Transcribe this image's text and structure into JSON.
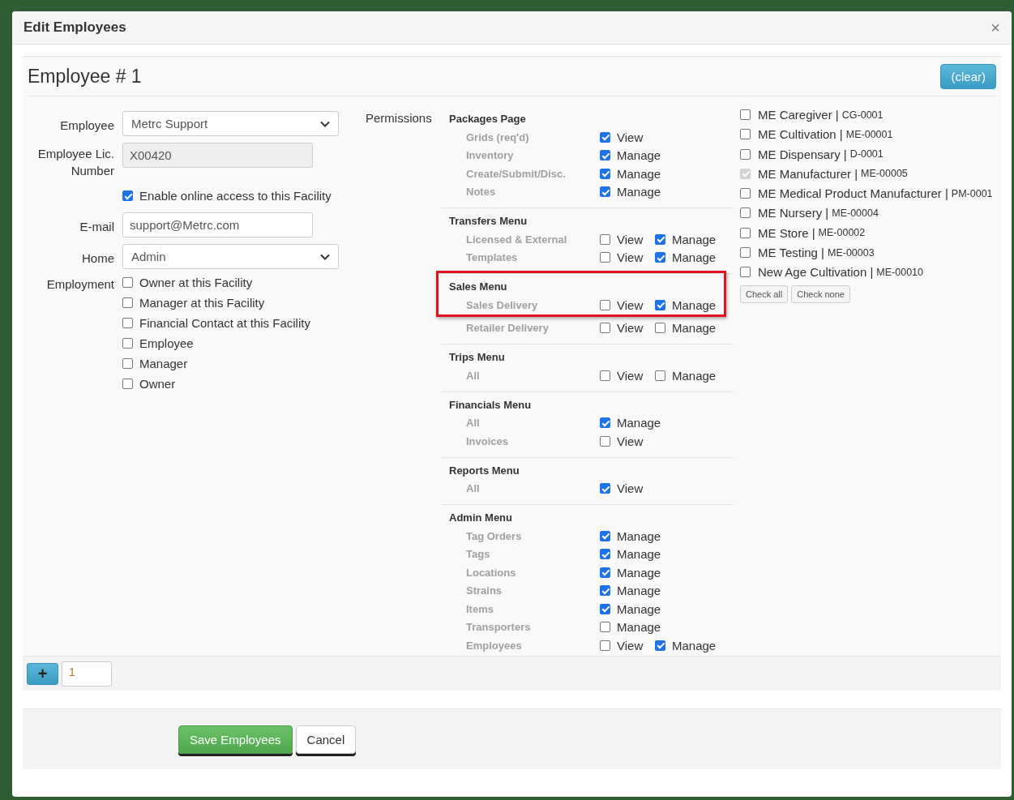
{
  "dialog": {
    "title": "Edit Employees",
    "close": "×"
  },
  "employee_heading": "Employee # 1",
  "clear_button": "(clear)",
  "form": {
    "employee": {
      "label": "Employee",
      "value": "Metrc Support"
    },
    "license": {
      "label": "Employee Lic. Number",
      "value": "X00420"
    },
    "online_access": {
      "label": "Enable online access to this Facility",
      "checked": true
    },
    "email": {
      "label": "E-mail",
      "value": "support@Metrc.com"
    },
    "home": {
      "label": "Home",
      "value": "Admin"
    },
    "employment": {
      "label": "Employment",
      "options": [
        {
          "label": "Owner at this Facility",
          "checked": false
        },
        {
          "label": "Manager at this Facility",
          "checked": false
        },
        {
          "label": "Financial Contact at this Facility",
          "checked": false
        },
        {
          "label": "Employee",
          "checked": false
        },
        {
          "label": "Manager",
          "checked": false
        },
        {
          "label": "Owner",
          "checked": false
        }
      ]
    }
  },
  "permissions": {
    "label": "Permissions",
    "groups": [
      {
        "title": "Packages Page",
        "highlighted": false,
        "rows": [
          {
            "label": "Grids (req'd)",
            "options": [
              {
                "label": "View",
                "checked": true
              }
            ]
          },
          {
            "label": "Inventory",
            "options": [
              {
                "label": "Manage",
                "checked": true
              }
            ]
          },
          {
            "label": "Create/Submit/Disc.",
            "options": [
              {
                "label": "Manage",
                "checked": true
              }
            ]
          },
          {
            "label": "Notes",
            "options": [
              {
                "label": "Manage",
                "checked": true
              }
            ]
          }
        ]
      },
      {
        "title": "Transfers Menu",
        "highlighted": false,
        "rows": [
          {
            "label": "Licensed & External",
            "options": [
              {
                "label": "View",
                "checked": false
              },
              {
                "label": "Manage",
                "checked": true
              }
            ]
          },
          {
            "label": "Templates",
            "options": [
              {
                "label": "View",
                "checked": false
              },
              {
                "label": "Manage",
                "checked": true
              }
            ]
          }
        ]
      },
      {
        "title": "Sales Menu",
        "highlighted": true,
        "rows": [
          {
            "label": "Sales Delivery",
            "options": [
              {
                "label": "View",
                "checked": false
              },
              {
                "label": "Manage",
                "checked": true
              }
            ]
          },
          {
            "label": "Retailer Delivery",
            "options": [
              {
                "label": "View",
                "checked": false
              },
              {
                "label": "Manage",
                "checked": false
              }
            ]
          }
        ]
      },
      {
        "title": "Trips Menu",
        "highlighted": false,
        "rows": [
          {
            "label": "All",
            "options": [
              {
                "label": "View",
                "checked": false
              },
              {
                "label": "Manage",
                "checked": false
              }
            ]
          }
        ]
      },
      {
        "title": "Financials Menu",
        "highlighted": false,
        "rows": [
          {
            "label": "All",
            "options": [
              {
                "label": "Manage",
                "checked": true
              }
            ]
          },
          {
            "label": "Invoices",
            "options": [
              {
                "label": "View",
                "checked": false
              }
            ]
          }
        ]
      },
      {
        "title": "Reports Menu",
        "highlighted": false,
        "rows": [
          {
            "label": "All",
            "options": [
              {
                "label": "View",
                "checked": true
              }
            ]
          }
        ]
      },
      {
        "title": "Admin Menu",
        "highlighted": false,
        "rows": [
          {
            "label": "Tag Orders",
            "options": [
              {
                "label": "Manage",
                "checked": true
              }
            ]
          },
          {
            "label": "Tags",
            "options": [
              {
                "label": "Manage",
                "checked": true
              }
            ]
          },
          {
            "label": "Locations",
            "options": [
              {
                "label": "Manage",
                "checked": true
              }
            ]
          },
          {
            "label": "Strains",
            "options": [
              {
                "label": "Manage",
                "checked": true
              }
            ]
          },
          {
            "label": "Items",
            "options": [
              {
                "label": "Manage",
                "checked": true
              }
            ]
          },
          {
            "label": "Transporters",
            "options": [
              {
                "label": "Manage",
                "checked": false
              }
            ]
          },
          {
            "label": "Employees",
            "options": [
              {
                "label": "View",
                "checked": false
              },
              {
                "label": "Manage",
                "checked": true
              }
            ]
          }
        ]
      }
    ]
  },
  "facilities": [
    {
      "name": "ME Caregiver |",
      "code": "CG-0001",
      "checked": false,
      "disabled": false
    },
    {
      "name": "ME Cultivation |",
      "code": "ME-00001",
      "checked": false,
      "disabled": false
    },
    {
      "name": "ME Dispensary |",
      "code": "D-0001",
      "checked": false,
      "disabled": false
    },
    {
      "name": "ME Manufacturer |",
      "code": "ME-00005",
      "checked": true,
      "disabled": true
    },
    {
      "name": "ME Medical Product Manufacturer |",
      "code": "PM-0001",
      "checked": false,
      "disabled": false
    },
    {
      "name": "ME Nursery |",
      "code": "ME-00004",
      "checked": false,
      "disabled": false
    },
    {
      "name": "ME Store |",
      "code": "ME-00002",
      "checked": false,
      "disabled": false
    },
    {
      "name": "ME Testing |",
      "code": "ME-00003",
      "checked": false,
      "disabled": false
    },
    {
      "name": "New Age Cultivation |",
      "code": "ME-00010",
      "checked": false,
      "disabled": false
    }
  ],
  "facility_buttons": [
    "Check all",
    "Check none"
  ],
  "add_row": {
    "button": "+",
    "count": "1"
  },
  "footer_buttons": [
    {
      "label": "Save Employees",
      "kind": "primary"
    },
    {
      "label": "Cancel",
      "kind": "default"
    }
  ]
}
